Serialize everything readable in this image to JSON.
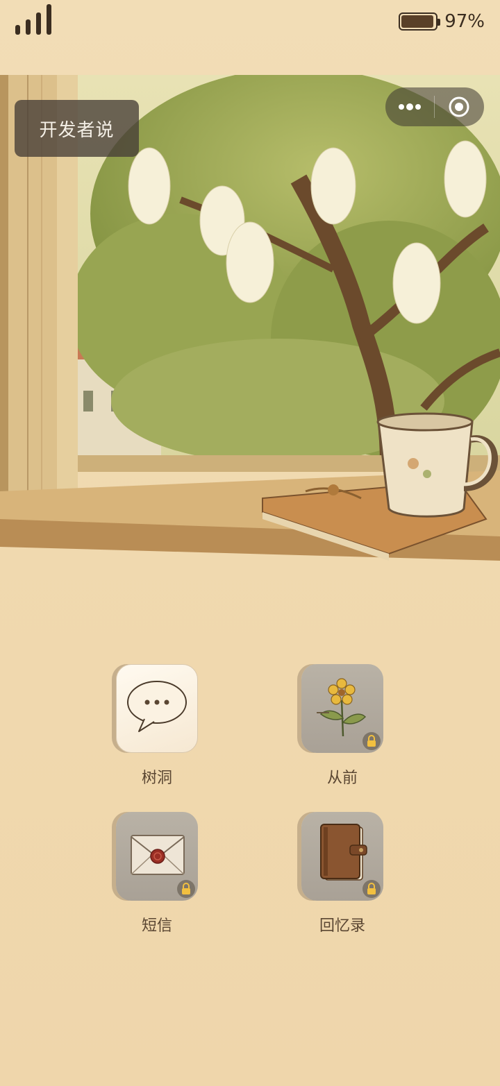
{
  "status_bar": {
    "battery_percent": "97%",
    "battery_level": 0.97
  },
  "header": {
    "developer_button_label": "开发者说"
  },
  "capsule": {
    "more_icon": "more-dots-icon",
    "close_icon": "target-close-icon"
  },
  "apps": [
    {
      "label": "树洞",
      "icon": "speech-bubble-icon",
      "locked": false
    },
    {
      "label": "从前",
      "icon": "flower-icon",
      "locked": true
    },
    {
      "label": "短信",
      "icon": "envelope-icon",
      "locked": true
    },
    {
      "label": "回忆录",
      "icon": "journal-icon",
      "locked": true
    }
  ],
  "colors": {
    "paper": "#f0d9af",
    "text": "#5a4632",
    "overlay": "#46403a"
  }
}
